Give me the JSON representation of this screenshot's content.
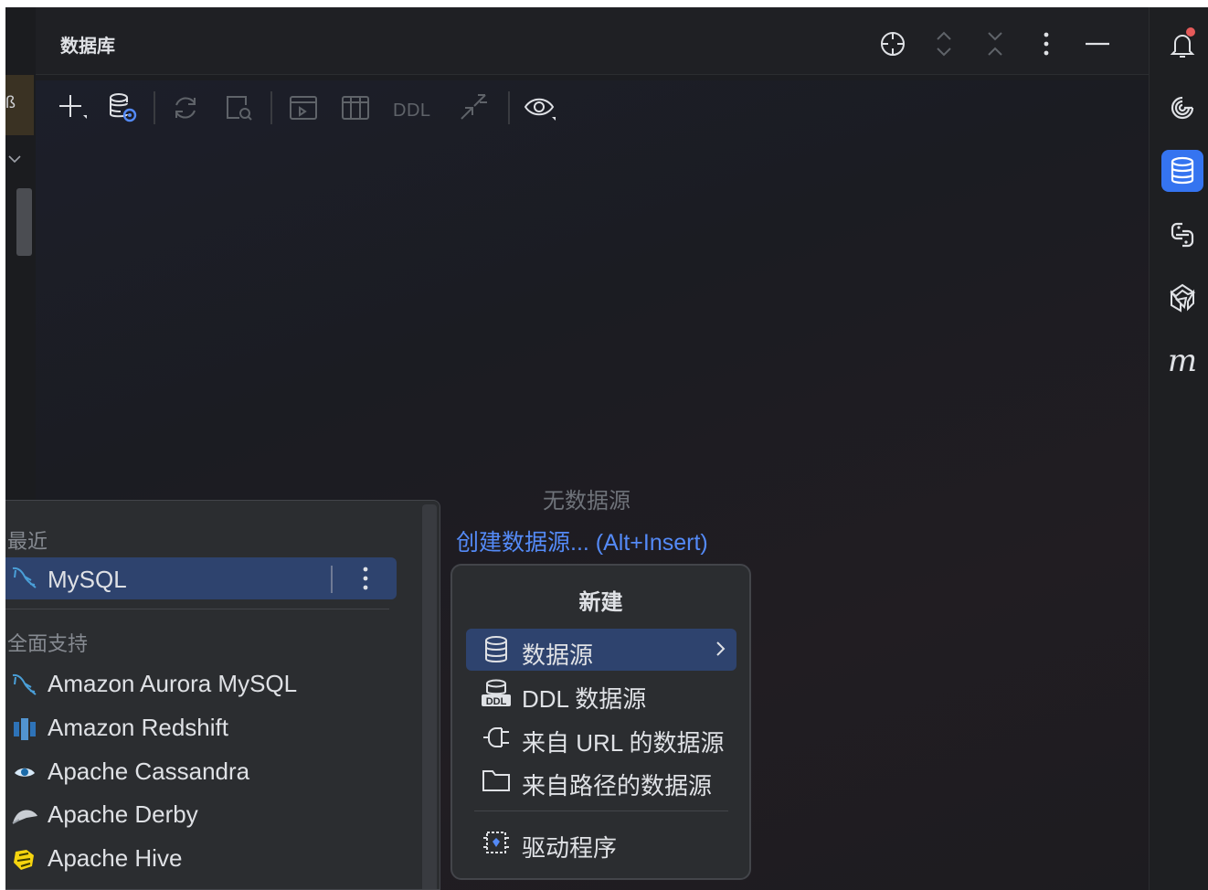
{
  "panel": {
    "title": "数据库"
  },
  "toolbar": {
    "ddl_label": "DDL"
  },
  "empty_state": {
    "message": "无数据源",
    "create_link": "创建数据源... (Alt+Insert)"
  },
  "dropdown": {
    "recent_header": "最近",
    "recent_item": {
      "label": "MySQL",
      "icon": "mysql-dolphin-icon"
    },
    "full_support_header": "全面支持",
    "items": [
      {
        "label": "Amazon Aurora MySQL",
        "icon": "mysql-dolphin-icon"
      },
      {
        "label": "Amazon Redshift",
        "icon": "redshift-icon"
      },
      {
        "label": "Apache Cassandra",
        "icon": "cassandra-eye-icon"
      },
      {
        "label": "Apache Derby",
        "icon": "derby-hat-icon"
      },
      {
        "label": "Apache Hive",
        "icon": "hive-bee-icon"
      }
    ]
  },
  "new_popup": {
    "title": "新建",
    "items": [
      {
        "label": "数据源",
        "icon": "database-icon",
        "selected": true,
        "has_submenu": true
      },
      {
        "label": "DDL 数据源",
        "icon": "ddl-database-icon"
      },
      {
        "label": "来自 URL 的数据源",
        "icon": "plug-icon"
      },
      {
        "label": "来自路径的数据源",
        "icon": "folder-icon"
      }
    ],
    "drivers": {
      "label": "驱动程序",
      "icon": "driver-icon"
    }
  },
  "colors": {
    "accent": "#3574f0",
    "selection": "#2e436e",
    "link": "#548af7",
    "notification_badge": "#e55a5a"
  }
}
